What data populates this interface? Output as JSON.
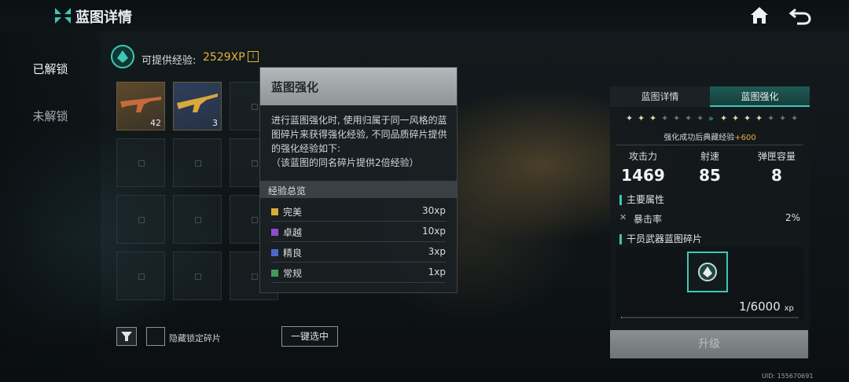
{
  "header": {
    "title": "蓝图详情"
  },
  "nav": {
    "unlocked": "已解锁",
    "locked": "未解锁"
  },
  "xp": {
    "label": "可提供经验:",
    "value": "2529XP"
  },
  "inventory": {
    "items": [
      {
        "count": "42",
        "rarity": "gold"
      },
      {
        "count": "3",
        "rarity": "blue"
      }
    ],
    "hide_locked_label": "隐藏锁定碎片",
    "select_all_label": "一键选中"
  },
  "popup": {
    "title": "蓝图强化",
    "description": "进行蓝图强化时, 使用归属于同一风格的蓝图碎片来获得强化经验, 不同品质碎片提供的强化经验如下:\n（该蓝图的同名碎片提供2倍经验）",
    "section_title": "经验总览",
    "rows": [
      {
        "name": "完美",
        "value": "30xp",
        "color": "#d9a93a"
      },
      {
        "name": "卓越",
        "value": "10xp",
        "color": "#8b4fc9"
      },
      {
        "name": "精良",
        "value": "3xp",
        "color": "#4f66c9"
      },
      {
        "name": "常规",
        "value": "1xp",
        "color": "#3f9c5a"
      }
    ]
  },
  "right_panel": {
    "tabs": [
      "蓝图详情",
      "蓝图强化"
    ],
    "active_tab": 1,
    "stars": {
      "before_filled": 3,
      "before_total": 7,
      "after_filled": 4,
      "after_total": 7
    },
    "bonus_text": "强化成功后典藏经验",
    "bonus_value": "+600",
    "stats": [
      {
        "label": "攻击力",
        "value": "1469"
      },
      {
        "label": "射速",
        "value": "85"
      },
      {
        "label": "弹匣容量",
        "value": "8"
      }
    ],
    "main_attr_title": "主要属性",
    "crit_label": "暴击率",
    "crit_value": "2%",
    "fragment_title": "干员武器蓝图碎片",
    "fragment_count": "1/6000",
    "fragment_unit": "xp",
    "progress": 0.0002,
    "upgrade_label": "升级"
  },
  "uid": "UID: 155670691",
  "colors": {
    "accent": "#3cc9b5",
    "xp_gold": "#e4b339"
  }
}
